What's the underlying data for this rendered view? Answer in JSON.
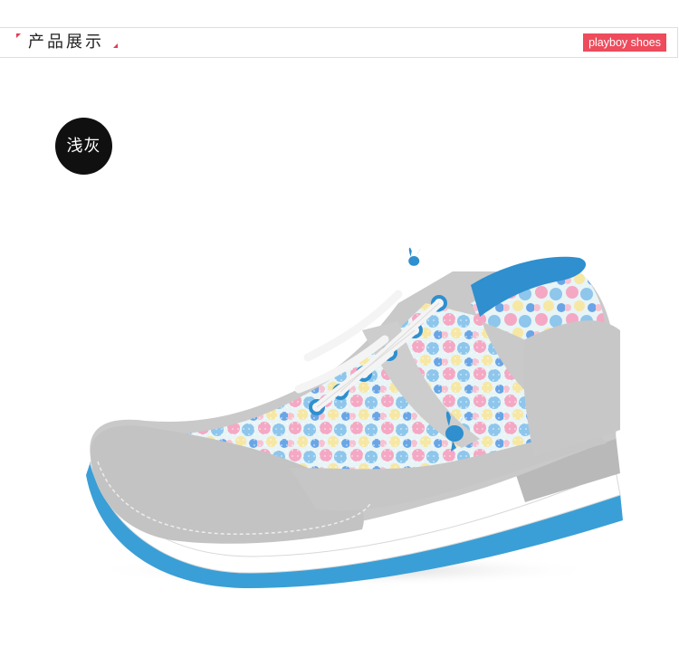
{
  "header": {
    "title": "产品展示",
    "brand_badge": "playboy shoes",
    "accent_color": "#e8384f"
  },
  "color_badge": {
    "label": "浅灰"
  },
  "product_image": {
    "icon": "sneaker-image"
  }
}
